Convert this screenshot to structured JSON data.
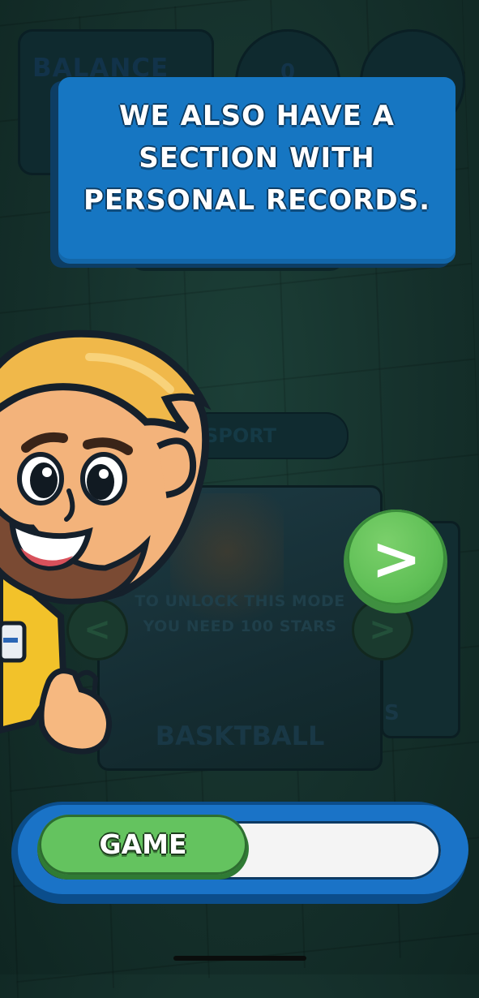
{
  "header": {
    "balance_label": "BALANCE",
    "stars_count": "0"
  },
  "tooltip": {
    "message": "WE ALSO HAVE A SECTION WITH PERSONAL RECORDS."
  },
  "sport_selector": {
    "label": "SPORT"
  },
  "mode_card": {
    "lock_message": "TO UNLOCK THIS MODE YOU NEED 100 STARS",
    "mode_name": "BASKTBALL",
    "side_card_partial_label": "S"
  },
  "navigation": {
    "prev_glyph": "<",
    "next_glyph": ">",
    "side_next_glyph": ">"
  },
  "progress": {
    "label": "GAME",
    "fraction": 0.5
  },
  "colors": {
    "tooltip_blue": "#1676c2",
    "accent_green": "#64c35f",
    "frame_blue": "#1a73c7"
  }
}
